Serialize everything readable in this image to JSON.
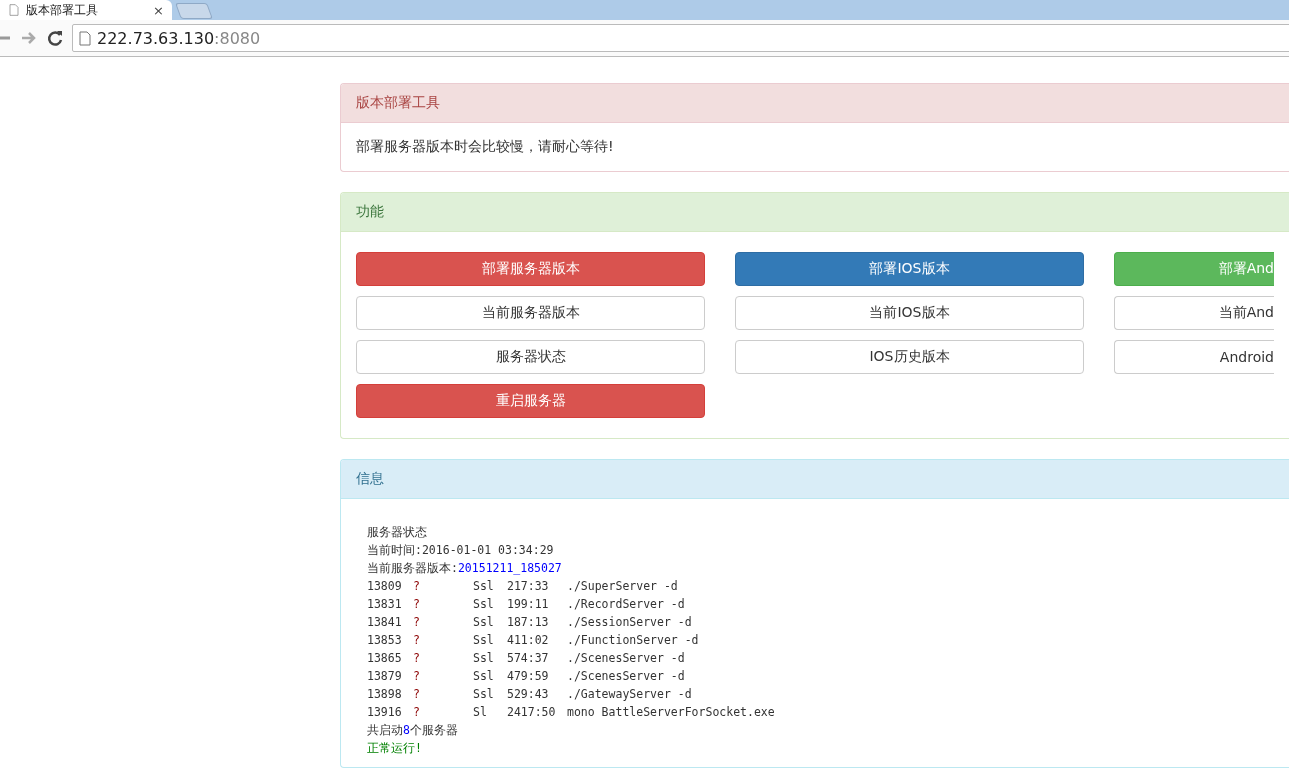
{
  "browser": {
    "tab_title": "版本部署工具",
    "close": "×",
    "url_host": "222.73.63.130",
    "url_port": ":8080"
  },
  "notice_panel": {
    "title": "版本部署工具",
    "body": "部署服务器版本时会比较慢，请耐心等待!"
  },
  "function_panel": {
    "title": "功能",
    "buttons": [
      {
        "label": "部署服务器版本",
        "kind": "danger"
      },
      {
        "label": "部署IOS版本",
        "kind": "primary"
      },
      {
        "label": "部署And",
        "kind": "success"
      },
      {
        "label": "当前服务器版本",
        "kind": "default"
      },
      {
        "label": "当前IOS版本",
        "kind": "default"
      },
      {
        "label": "当前And",
        "kind": "default"
      },
      {
        "label": "服务器状态",
        "kind": "default"
      },
      {
        "label": "IOS历史版本",
        "kind": "default"
      },
      {
        "label": "Android",
        "kind": "default"
      },
      {
        "label": "重启服务器",
        "kind": "danger"
      }
    ]
  },
  "info_panel": {
    "title": "信息",
    "heading": "服务器状态",
    "time_label": "当前时间:",
    "time_value": "2016-01-01 03:34:29",
    "version_label": "当前服务器版本:",
    "version_value": "20151211_185027",
    "processes": [
      {
        "pid": "13809",
        "tty": "?",
        "stat": "Ssl",
        "time": "217:33",
        "command": "./SuperServer -d"
      },
      {
        "pid": "13831",
        "tty": "?",
        "stat": "Ssl",
        "time": "199:11",
        "command": "./RecordServer -d"
      },
      {
        "pid": "13841",
        "tty": "?",
        "stat": "Ssl",
        "time": "187:13",
        "command": "./SessionServer -d"
      },
      {
        "pid": "13853",
        "tty": "?",
        "stat": "Ssl",
        "time": "411:02",
        "command": "./FunctionServer -d"
      },
      {
        "pid": "13865",
        "tty": "?",
        "stat": "Ssl",
        "time": "574:37",
        "command": "./ScenesServer -d"
      },
      {
        "pid": "13879",
        "tty": "?",
        "stat": "Ssl",
        "time": "479:59",
        "command": "./ScenesServer -d"
      },
      {
        "pid": "13898",
        "tty": "?",
        "stat": "Ssl",
        "time": "529:43",
        "command": "./GatewayServer -d"
      },
      {
        "pid": "13916",
        "tty": "?",
        "stat": "Sl",
        "time": "2417:50",
        "command": "mono BattleServerForSocket.exe"
      }
    ],
    "summary_prefix": "共启动",
    "count": "8",
    "summary_suffix": "个服务器",
    "status": "正常运行!"
  }
}
